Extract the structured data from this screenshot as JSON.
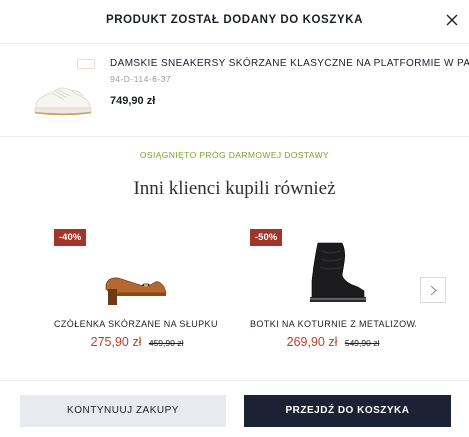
{
  "header": {
    "title": "PRODUKT ZOSTAŁ DODANY DO KOSZYKA",
    "close_icon": "close-icon"
  },
  "added_product": {
    "name": "DAMSKIE SNEAKERSY SKÓRZANE KLASYCZNE NA PLATFORMIE W PASY",
    "code": "94-D-114-6-37",
    "price": "749,90 zł",
    "image_icon": "white-sneaker-image"
  },
  "shipping_notice": "OSIĄGNIĘTO PRÓG DARMOWEJ DOSTAWY",
  "recommendations": {
    "title": "Inni klienci kupili również",
    "items": [
      {
        "badge": "-40%",
        "name": "CZÓŁENKA SKÓRZANE NA SŁUPKU",
        "price": "275,90 zł",
        "old_price": "459,90 zł",
        "image_icon": "brown-pump-image"
      },
      {
        "badge": "-50%",
        "name": "BOTKI NA KOTURNIE Z METALIZOWANĄ",
        "price": "269,90 zł",
        "old_price": "549,90 zł",
        "image_icon": "black-ankle-boot-image"
      }
    ],
    "next_icon": "chevron-right-icon"
  },
  "footer": {
    "continue_label": "KONTYNUUJ ZAKUPY",
    "cart_label": "PRZEJDŹ DO KOSZYKA"
  },
  "colors": {
    "badge": "#a0352a",
    "sale_price": "#b8402d",
    "shipping_notice": "#7aa52b",
    "primary_button": "#1b2233"
  }
}
